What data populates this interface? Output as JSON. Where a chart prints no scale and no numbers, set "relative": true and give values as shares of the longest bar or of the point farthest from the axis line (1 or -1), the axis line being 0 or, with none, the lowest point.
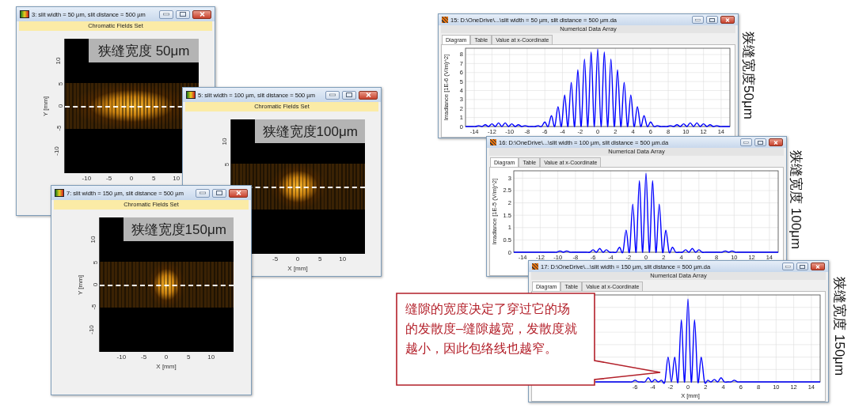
{
  "left_windows": [
    {
      "title": "3: slit width = 50 µm, slit distance = 500 µm",
      "subtitle": "Chromatic Fields Set",
      "overlay_label": "狭缝宽度 50μm",
      "ylabel": "Y [mm]",
      "yticks": [
        "10",
        "5",
        "0",
        "-5",
        "-10"
      ],
      "xticks": [
        "-10",
        "-5",
        "0",
        "5",
        "10"
      ]
    },
    {
      "title": "5: slit width = 100 µm, slit distance = 500 µm",
      "subtitle": "Chromatic Fields Set",
      "overlay_label": "狭缝宽度100μm",
      "yticks": [
        "10",
        "5"
      ],
      "xticks": [
        "-5",
        "0",
        "5",
        "10"
      ],
      "xlabel": "X [mm]"
    },
    {
      "title": "7: slit width = 150 µm, slit distance = 500 µm",
      "subtitle": "Chromatic Fields Set",
      "overlay_label": "狭缝宽度150μm",
      "ylabel": "Y [mm]",
      "yticks": [
        "10",
        "5",
        "0",
        "-5",
        "-10"
      ],
      "xticks": [
        "-10",
        "-5",
        "0",
        "5",
        "10"
      ],
      "xlabel": "X [mm]"
    }
  ],
  "right_windows": [
    {
      "title": "15: D:\\OneDrive\\...\\slit width = 50 µm, slit distance = 500 µm.da",
      "subtitle": "Numerical Data Array",
      "tabs": [
        {
          "label": "Diagram",
          "selected": true
        },
        {
          "label": "Table",
          "selected": false
        },
        {
          "label": "Value at x-Coordinate",
          "selected": false
        }
      ],
      "chart_data": {
        "type": "line",
        "grid": true,
        "ylabel": "Irradiance [1E-6 (V/m)^2]",
        "xlim": [
          -15,
          15
        ],
        "ylim": [
          0,
          8.7
        ],
        "xticks": [
          -14,
          -12,
          -10,
          -8,
          -6,
          -4,
          -2,
          0,
          2,
          4,
          6,
          8,
          10,
          12,
          14
        ],
        "yticks": [
          0,
          1,
          2,
          3,
          4,
          5,
          6,
          7,
          8
        ],
        "x": [
          -15,
          -14.625,
          -14.25,
          -13.875,
          -13.5,
          -13.125,
          -12.75,
          -12.375,
          -12,
          -11.625,
          -11.25,
          -10.875,
          -10.5,
          -10.125,
          -9.75,
          -9.375,
          -9,
          -8.625,
          -8.25,
          -7.875,
          -7.5,
          -7.125,
          -6.75,
          -6.375,
          -6,
          -5.625,
          -5.25,
          -4.875,
          -4.5,
          -4.125,
          -3.75,
          -3.375,
          -3,
          -2.625,
          -2.25,
          -1.875,
          -1.5,
          -1.125,
          -0.75,
          -0.375,
          0,
          0.375,
          0.75,
          1.125,
          1.5,
          1.875,
          2.25,
          2.625,
          3,
          3.375,
          3.75,
          4.125,
          4.5,
          4.875,
          5.25,
          5.625,
          6,
          6.375,
          6.75,
          7.125,
          7.5,
          7.875,
          8.25,
          8.625,
          9,
          9.375,
          9.75,
          10.125,
          10.5,
          10.875,
          11.25,
          11.625,
          12,
          12.375,
          12.75,
          13.125,
          13.5,
          13.875,
          14.25,
          14.625,
          15
        ],
        "series": [
          {
            "color": "#0000ff",
            "values": [
              0,
              0,
              0,
              0,
              0.1,
              0,
              0.2,
              0,
              0.3,
              0,
              0.4,
              0,
              0.4,
              0,
              0.3,
              0,
              0.2,
              0,
              0.1,
              0,
              0,
              0,
              0.1,
              0,
              0.5,
              0,
              1.2,
              0,
              2.2,
              0,
              3.5,
              0,
              4.9,
              0,
              6.3,
              0,
              7.5,
              0,
              8.3,
              0,
              8.6,
              0,
              8.3,
              0,
              7.5,
              0,
              6.3,
              0,
              4.9,
              0,
              3.5,
              0,
              2.2,
              0,
              1.2,
              0,
              0.5,
              0,
              0.1,
              0,
              0,
              0,
              0.1,
              0,
              0.2,
              0,
              0.3,
              0,
              0.4,
              0,
              0.4,
              0,
              0.3,
              0,
              0.2,
              0,
              0.1,
              0,
              0,
              0,
              0
            ]
          }
        ]
      }
    },
    {
      "title": "16: D:\\OneDrive\\...\\slit width = 100 µm, slit distance = 500 µm.da",
      "subtitle": "Numerical Data Array",
      "tabs": [
        {
          "label": "Diagram",
          "selected": true
        },
        {
          "label": "Table",
          "selected": false
        },
        {
          "label": "Value at x-Coordinate",
          "selected": false
        }
      ],
      "chart_data": {
        "type": "line",
        "grid": true,
        "ylabel": "Irradiance [1E-5 (V/m)^2]",
        "xlim": [
          -15,
          15
        ],
        "ylim": [
          0,
          3.3
        ],
        "xticks": [
          -14,
          -12,
          -10,
          -8,
          -6,
          -4,
          -2,
          0,
          2,
          4,
          6,
          8,
          10,
          12,
          14
        ],
        "yticks": [
          0,
          0.5,
          1,
          1.5,
          2,
          2.5,
          3
        ],
        "x": [
          -15,
          -14.625,
          -14.25,
          -13.875,
          -13.5,
          -13.125,
          -12.75,
          -12.375,
          -12,
          -11.625,
          -11.25,
          -10.875,
          -10.5,
          -10.125,
          -9.75,
          -9.375,
          -9,
          -8.625,
          -8.25,
          -7.875,
          -7.5,
          -7.125,
          -6.75,
          -6.375,
          -6,
          -5.625,
          -5.25,
          -4.875,
          -4.5,
          -4.125,
          -3.75,
          -3.375,
          -3,
          -2.625,
          -2.25,
          -1.875,
          -1.5,
          -1.125,
          -0.75,
          -0.375,
          0,
          0.375,
          0.75,
          1.125,
          1.5,
          1.875,
          2.25,
          2.625,
          3,
          3.375,
          3.75,
          4.125,
          4.5,
          4.875,
          5.25,
          5.625,
          6,
          6.375,
          6.75,
          7.125,
          7.5,
          7.875,
          8.25,
          8.625,
          9,
          9.375,
          9.75,
          10.125,
          10.5,
          10.875,
          11.25,
          11.625,
          12,
          12.375,
          12.75,
          13.125,
          13.5,
          13.875,
          14.25,
          14.625,
          15
        ],
        "series": [
          {
            "color": "#0000ff",
            "values": [
              0,
              0,
              0,
              0,
              0,
              0,
              0,
              0,
              0,
              0,
              0,
              0,
              0,
              0,
              0.05,
              0,
              0.05,
              0,
              0,
              0,
              0,
              0,
              0,
              0,
              0.1,
              0,
              0.15,
              0,
              0.1,
              0,
              0,
              0,
              0.2,
              0,
              0.9,
              0,
              1.95,
              0,
              2.9,
              0,
              3.2,
              0,
              2.9,
              0,
              1.95,
              0,
              0.9,
              0,
              0.2,
              0,
              0,
              0,
              0.1,
              0,
              0.15,
              0,
              0.1,
              0,
              0,
              0,
              0,
              0,
              0,
              0,
              0.05,
              0,
              0.05,
              0,
              0,
              0,
              0,
              0,
              0,
              0,
              0,
              0,
              0,
              0,
              0,
              0,
              0
            ]
          }
        ]
      }
    },
    {
      "title": "17: D:\\OneDrive\\...\\slit width = 150 µm, slit distance = 500 µm.da",
      "subtitle": "Numerical Data Array",
      "tabs": [
        {
          "label": "Diagram",
          "selected": true
        },
        {
          "label": "Table",
          "selected": false
        },
        {
          "label": "Value at x-Coordinate",
          "selected": false
        }
      ],
      "chart_data": {
        "type": "line",
        "grid": true,
        "relative": true,
        "xlabel": "X [mm]",
        "xlim": [
          -15,
          15
        ],
        "xticks": [
          -6,
          -4,
          -2,
          0,
          2,
          4,
          6,
          8,
          10,
          12,
          14
        ],
        "x": [
          -10.5,
          -10.125,
          -9.75,
          -9.375,
          -9,
          -8.625,
          -8.25,
          -7.875,
          -7.5,
          -7.125,
          -6.75,
          -6.375,
          -6,
          -5.625,
          -5.25,
          -4.875,
          -4.5,
          -4.125,
          -3.75,
          -3.375,
          -3,
          -2.625,
          -2.25,
          -1.875,
          -1.5,
          -1.125,
          -0.75,
          -0.375,
          0,
          0.375,
          0.75,
          1.125,
          1.5,
          1.875,
          2.25,
          2.625,
          3,
          3.375,
          3.75,
          4.125,
          4.5,
          4.875,
          5.25,
          5.625,
          6,
          6.375,
          6.75,
          7.125,
          7.5,
          7.875,
          8.25,
          8.625,
          9,
          9.375,
          9.75,
          10.125,
          10.5,
          10.875,
          11.25,
          11.625,
          12,
          12.375,
          12.75,
          13.125,
          13.5,
          13.875,
          14.25,
          14.625,
          15
        ],
        "series": [
          {
            "color": "#0000ff",
            "values": [
              0,
              0,
              0,
              0,
              0,
              0,
              0,
              0,
              0,
              0,
              0,
              0,
              0.02,
              0,
              0,
              0,
              0.05,
              0,
              0.03,
              0,
              0.02,
              0,
              0.3,
              0,
              0.3,
              0,
              0.75,
              0,
              1,
              0,
              0.75,
              0,
              0.3,
              0,
              0.02,
              0,
              0.03,
              0,
              0.05,
              0,
              0,
              0,
              0.02,
              0,
              0,
              0,
              0,
              0,
              0,
              0,
              0,
              0,
              0,
              0,
              0,
              0,
              0,
              0,
              0,
              0,
              0,
              0,
              0,
              0,
              0,
              0,
              0,
              0,
              0
            ]
          }
        ]
      }
    }
  ],
  "side_labels": [
    "狭缝宽度50μm",
    "狭缝宽度 100μm",
    "狭缝宽度 150μm"
  ],
  "callout": {
    "text": "缝隙的宽度决定了穿过它的场的发散度–缝隙越宽，发散度就越小，因此包络线也越窄。"
  }
}
